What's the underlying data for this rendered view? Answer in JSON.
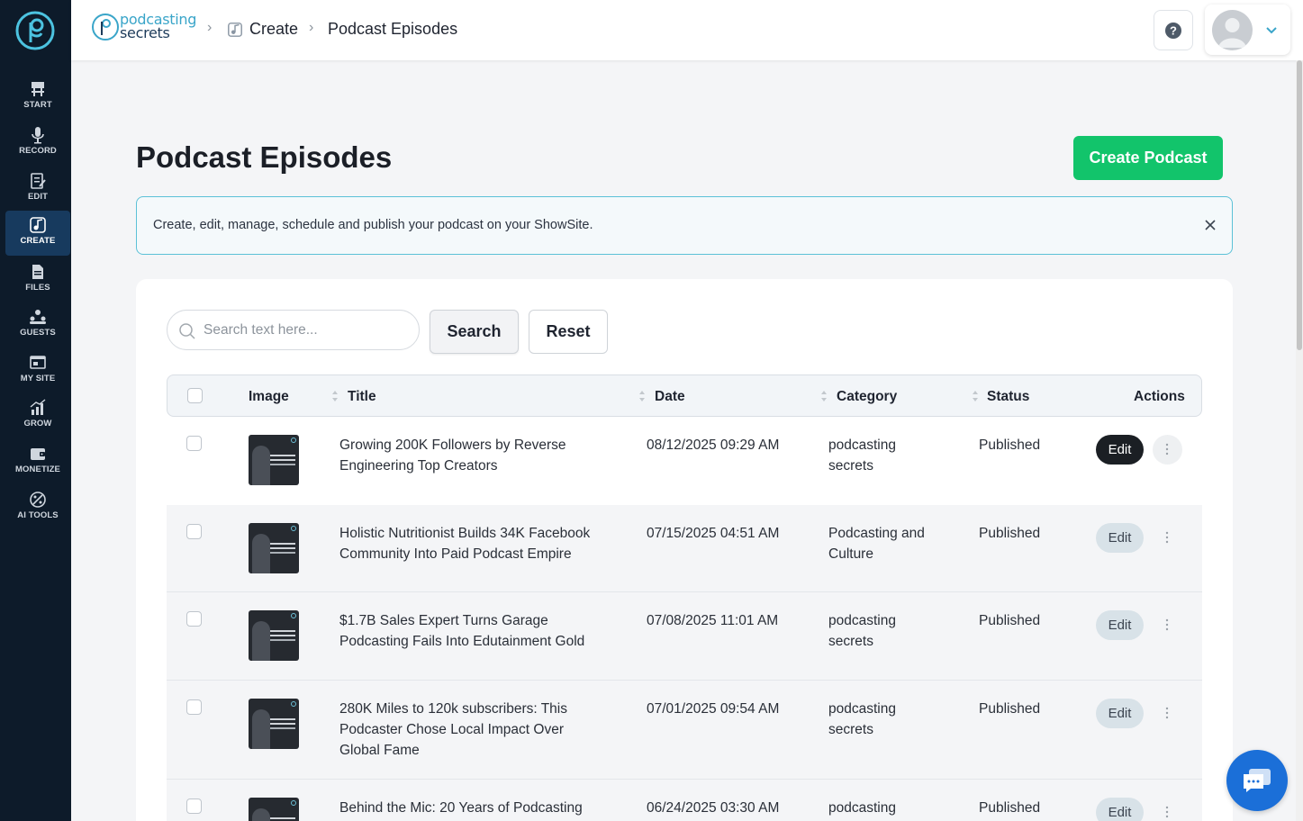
{
  "sidebar": {
    "items": [
      {
        "label": "START",
        "icon": "start-sign-icon"
      },
      {
        "label": "RECORD",
        "icon": "microphone-icon"
      },
      {
        "label": "EDIT",
        "icon": "edit-document-icon"
      },
      {
        "label": "CREATE",
        "icon": "create-music-icon",
        "active": true
      },
      {
        "label": "FILES",
        "icon": "files-icon"
      },
      {
        "label": "GUESTS",
        "icon": "guests-icon"
      },
      {
        "label": "MY SITE",
        "icon": "website-icon"
      },
      {
        "label": "GROW",
        "icon": "growth-chart-icon"
      },
      {
        "label": "MONETIZE",
        "icon": "wallet-icon"
      },
      {
        "label": "AI TOOLS",
        "icon": "ai-tools-icon"
      }
    ]
  },
  "header": {
    "brand_line1": "podcasting",
    "brand_line2": "secrets",
    "breadcrumb": [
      "Create",
      "Podcast Episodes"
    ]
  },
  "page": {
    "title": "Podcast Episodes",
    "create_button": "Create Podcast",
    "info_text": "Create, edit, manage, schedule and publish your podcast on your ShowSite."
  },
  "search": {
    "placeholder": "Search text here...",
    "search_label": "Search",
    "reset_label": "Reset"
  },
  "table": {
    "columns": [
      "Image",
      "Title",
      "Date",
      "Category",
      "Status",
      "Actions"
    ],
    "edit_label": "Edit",
    "rows": [
      {
        "title_l1": "Growing 200K Followers by Reverse",
        "title_l2": "Engineering Top Creators",
        "title_l3": "",
        "date": "08/12/2025 09:29 AM",
        "cat_l1": "podcasting",
        "cat_l2": "secrets",
        "status": "Published"
      },
      {
        "title_l1": "Holistic Nutritionist Builds 34K Facebook",
        "title_l2": "Community Into Paid Podcast Empire",
        "title_l3": "",
        "date": "07/15/2025 04:51 AM",
        "cat_l1": "Podcasting and",
        "cat_l2": "Culture",
        "status": "Published"
      },
      {
        "title_l1": "$1.7B Sales Expert Turns Garage",
        "title_l2": "Podcasting Fails Into Edutainment Gold",
        "title_l3": "",
        "date": "07/08/2025 11:01 AM",
        "cat_l1": "podcasting",
        "cat_l2": "secrets",
        "status": "Published"
      },
      {
        "title_l1": "280K Miles to 120k subscribers: This",
        "title_l2": "Podcaster Chose Local Impact Over",
        "title_l3": "Global Fame",
        "date": "07/01/2025 09:54 AM",
        "cat_l1": "podcasting",
        "cat_l2": "secrets",
        "status": "Published"
      },
      {
        "title_l1": "Behind the Mic: 20 Years of Podcasting",
        "title_l2": "",
        "title_l3": "",
        "date": "06/24/2025 03:30 AM",
        "cat_l1": "podcasting",
        "cat_l2": "",
        "status": "Published"
      }
    ]
  },
  "colors": {
    "sidebar_bg": "#0d1b2a",
    "accent_green": "#12c46b",
    "info_border": "#5cc1d7",
    "chat_blue": "#1b6fd8"
  }
}
